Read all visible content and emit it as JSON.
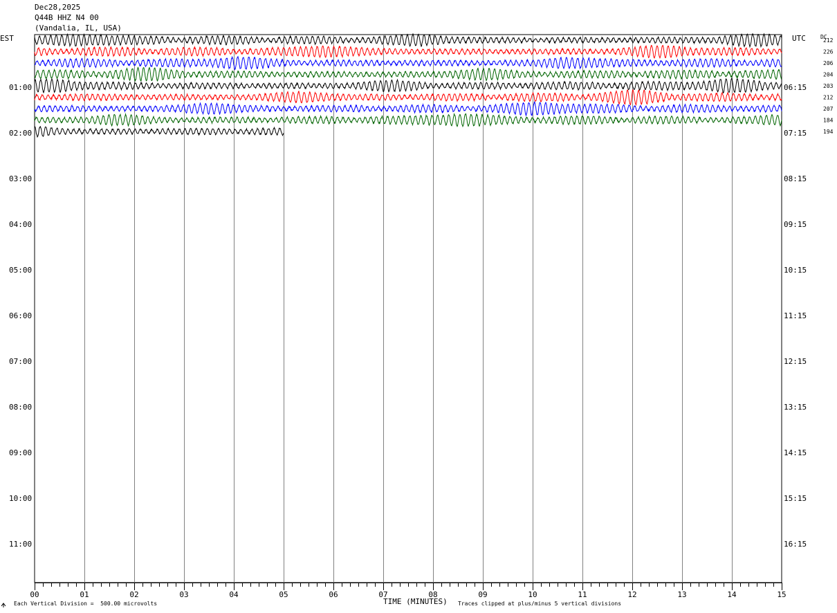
{
  "header": {
    "date": "Dec28,2025",
    "station": "Q44B HHZ N4 00",
    "location": "(Vandalia, IL, USA)"
  },
  "left_zone_label": "EST",
  "right_zone_label": "UTC",
  "dc_label": "DC",
  "footer": {
    "scale_note": "Each Vertical Division =  500.00 microvolts",
    "xlabel": "TIME (MINUTES)",
    "clip_note": "Traces clipped at plus/minus 5 vertical divisions"
  },
  "chart_data": {
    "type": "line",
    "title": "Dec28,2025 Q44B HHZ N4 00 (Vandalia, IL, USA)",
    "xlabel": "TIME (MINUTES)",
    "ylabel": "",
    "xlim": [
      0,
      15
    ],
    "x_ticks": [
      "00",
      "01",
      "02",
      "03",
      "04",
      "05",
      "06",
      "07",
      "08",
      "09",
      "10",
      "11",
      "12",
      "13",
      "14",
      "15"
    ],
    "grid": "vertical lines every minute",
    "trace_interval_minutes": 15,
    "hour_labels_left": [
      "01:00",
      "02:00",
      "03:00",
      "04:00",
      "05:00",
      "06:00",
      "07:00",
      "08:00",
      "09:00",
      "10:00",
      "11:00"
    ],
    "hour_labels_right": [
      "06:15",
      "07:15",
      "08:15",
      "09:15",
      "10:15",
      "11:15",
      "12:15",
      "13:15",
      "14:15",
      "15:15",
      "16:15"
    ],
    "color_cycle": [
      "#000000",
      "#ff0000",
      "#0000ff",
      "#006400"
    ],
    "traces": [
      {
        "dc": "212",
        "color": "#000000",
        "end_minute": 15
      },
      {
        "dc": "226",
        "color": "#ff0000",
        "end_minute": 15
      },
      {
        "dc": "206",
        "color": "#0000ff",
        "end_minute": 15
      },
      {
        "dc": "204",
        "color": "#006400",
        "end_minute": 15
      },
      {
        "dc": "203",
        "color": "#000000",
        "end_minute": 15
      },
      {
        "dc": "212",
        "color": "#ff0000",
        "end_minute": 15
      },
      {
        "dc": "207",
        "color": "#0000ff",
        "end_minute": 15
      },
      {
        "dc": "184",
        "color": "#006400",
        "end_minute": 15
      },
      {
        "dc": "194",
        "color": "#000000",
        "end_minute": 5
      }
    ]
  }
}
